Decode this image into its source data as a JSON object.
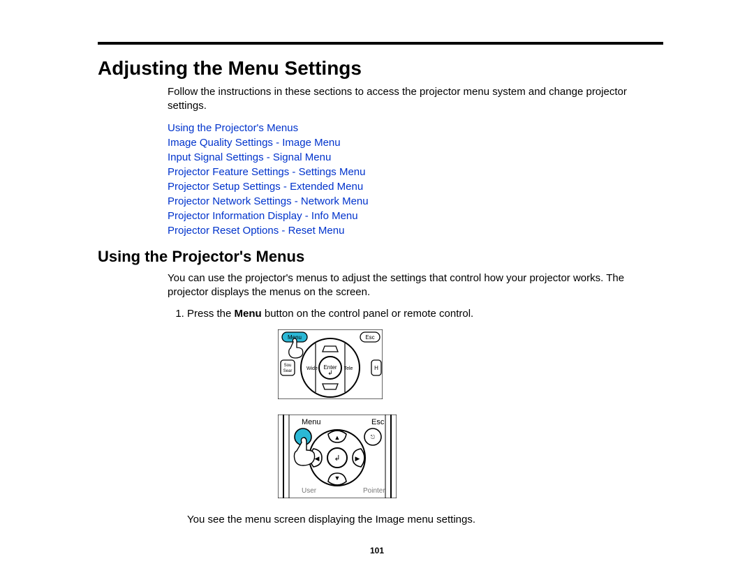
{
  "page": {
    "h1": "Adjusting the Menu Settings",
    "intro": "Follow the instructions in these sections to access the projector menu system and change projector settings.",
    "links": [
      "Using the Projector's Menus",
      "Image Quality Settings - Image Menu",
      "Input Signal Settings - Signal Menu",
      "Projector Feature Settings - Settings Menu",
      "Projector Setup Settings - Extended Menu",
      "Projector Network Settings - Network Menu",
      "Projector Information Display - Info Menu",
      "Projector Reset Options - Reset Menu"
    ],
    "h2": "Using the Projector's Menus",
    "sec_intro": "You can use the projector's menus to adjust the settings that control how your projector works. The projector displays the menus on the screen.",
    "step1_pre": "Press the ",
    "step1_bold": "Menu",
    "step1_post": " button on the control panel or remote control.",
    "step1_after": "You see the menu screen displaying the Image menu settings.",
    "page_number": "101",
    "fig1": {
      "menu": "Menu",
      "esc": "Esc",
      "enter": "Enter",
      "sou": "Sou",
      "search": "Search",
      "wide": "Wide",
      "tele": "Tele",
      "h": "H"
    },
    "fig2": {
      "menu": "Menu",
      "esc": "Esc",
      "user": "User",
      "pointer": "Pointer"
    }
  }
}
